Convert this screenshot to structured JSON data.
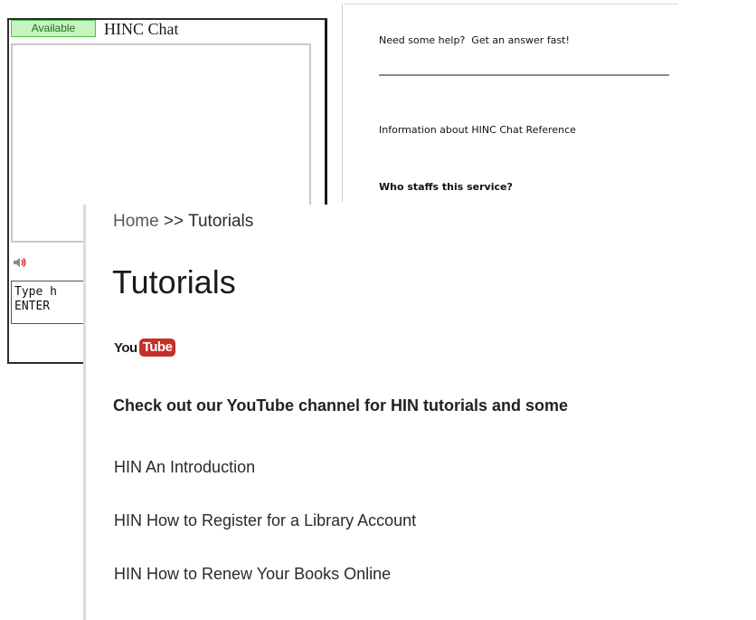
{
  "chat": {
    "status": "Available",
    "title": "HINC Chat",
    "input_text": "Type h\nENTER",
    "help_text": "Need some help?  Get an answer fast!",
    "info_text": "Information about HINC Chat Reference",
    "staff_heading": "Who staffs this service?",
    "status_color": "#c6f3c0"
  },
  "tutorials": {
    "breadcrumb": {
      "home": "Home",
      "separator": " >> ",
      "current": "Tutorials"
    },
    "title": "Tutorials",
    "youtube_logo": {
      "you": "You",
      "tube": "Tube",
      "icon": "youtube-logo",
      "brand_color": "#c4302b"
    },
    "intro": "Check out our YouTube channel for HIN tutorials and some",
    "links": [
      {
        "label": "HIN An Introduction"
      },
      {
        "label": "HIN How to Register for a Library Account"
      },
      {
        "label": "HIN How to Renew Your Books Online"
      }
    ]
  }
}
